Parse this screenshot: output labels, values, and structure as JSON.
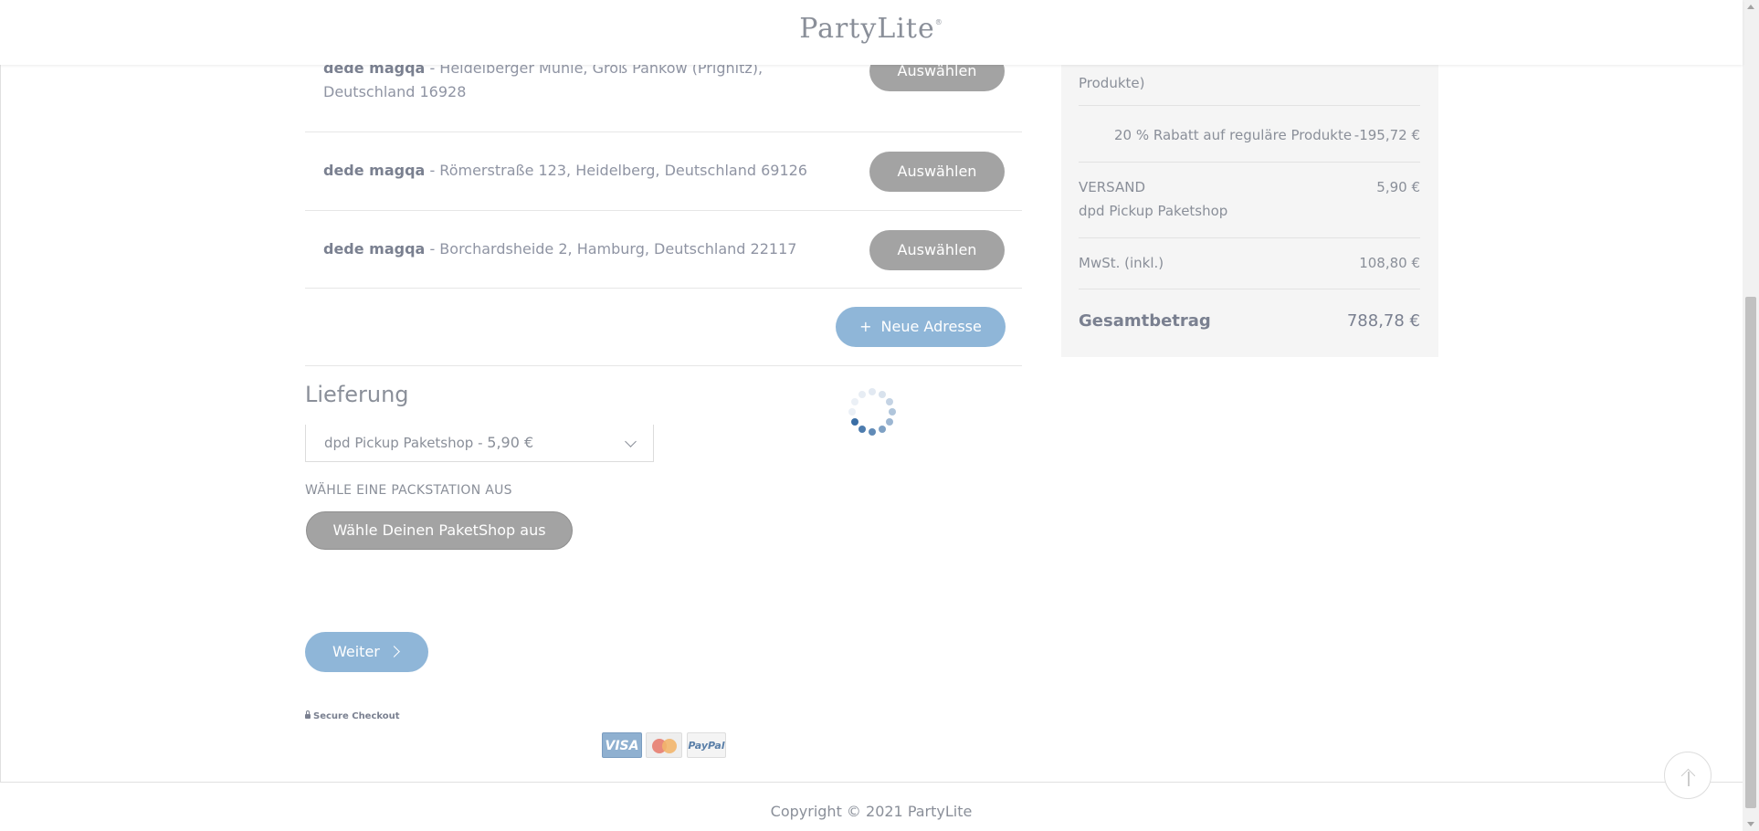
{
  "header": {
    "logo": "PartyLite",
    "logo_mark": "®"
  },
  "addresses": [
    {
      "name": "dede magqa",
      "text": " - Heidelberger Mühle, Groß Pankow (Prignitz), Deutschland 16928",
      "button": "Auswählen"
    },
    {
      "name": "dede magqa",
      "text": " - Römerstraße 123, Heidelberg, Deutschland 69126",
      "button": "Auswählen"
    },
    {
      "name": "dede magqa",
      "text": " - Borchardsheide 2, Hamburg, Deutschland 22117",
      "button": "Auswählen"
    }
  ],
  "new_address": {
    "icon": "+",
    "label": "Neue Adresse"
  },
  "delivery": {
    "title": "Lieferung",
    "selected_method": "dpd Pickup Paketshop - ",
    "selected_price": "5,90 €",
    "pack_label": "WÄHLE EINE PACKSTATION AUS",
    "pack_button": "Wähle Deinen PaketShop aus"
  },
  "continue_button": "Weiter",
  "secure_checkout": "Secure Checkout",
  "payment_cards": {
    "visa": "VISA",
    "paypal": "PayPal"
  },
  "summary": {
    "partial_text": "Produkte)",
    "discount_label": "20 % Rabatt auf reguläre Produkte",
    "discount_value": "-195,72 €",
    "shipping_label": "VERSAND",
    "shipping_method": "dpd Pickup Paketshop",
    "shipping_value": "5,90 €",
    "vat_label": "MwSt. (inkl.)",
    "vat_value": "108,80 €",
    "total_label": "Gesamtbetrag",
    "total_value": "788,78 €"
  },
  "footer": {
    "copyright": "Copyright © 2021 PartyLite"
  },
  "colors": {
    "accent": "#8fb6d8",
    "button_gray": "#a3a3a3",
    "text": "#8a8f99",
    "summary_bg": "#f5f5f5"
  }
}
